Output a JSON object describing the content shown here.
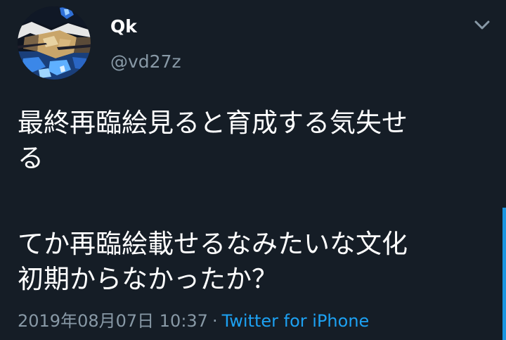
{
  "user": {
    "display_name": "Qk",
    "handle": "@vd27z"
  },
  "icons": {
    "menu": "chevron-down-icon",
    "avatar": "profile-picture"
  },
  "tweet": {
    "lines": [
      "最終再臨絵見ると育成する気失せ",
      "る",
      "てか再臨絵載せるなみたいな文化",
      "初期からなかったか？"
    ]
  },
  "meta": {
    "timestamp": "2019年08月07日 10:37",
    "separator": "·",
    "source": "Twitter for iPhone"
  },
  "colors": {
    "background": "#151d26",
    "text": "#ffffff",
    "secondary_text": "#8899a6",
    "link": "#1da1f2",
    "scroll_indicator": "#1b95e0"
  }
}
